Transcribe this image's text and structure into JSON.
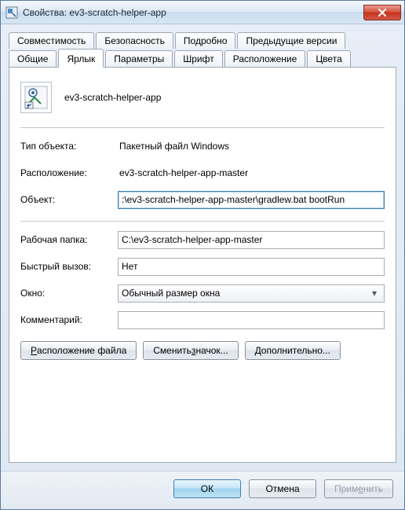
{
  "title": "Свойства: ev3-scratch-helper-app",
  "tabs_row1": [
    {
      "label": "Совместимость"
    },
    {
      "label": "Безопасность"
    },
    {
      "label": "Подробно"
    },
    {
      "label": "Предыдущие версии"
    }
  ],
  "tabs_row2": [
    {
      "label": "Общие"
    },
    {
      "label": "Ярлык"
    },
    {
      "label": "Параметры"
    },
    {
      "label": "Шрифт"
    },
    {
      "label": "Расположение"
    },
    {
      "label": "Цвета"
    }
  ],
  "active_tab": "Ярлык",
  "app_name": "ev3-scratch-helper-app",
  "fields": {
    "type_label": "Тип объекта:",
    "type_value": "Пакетный файл Windows",
    "location_label": "Расположение:",
    "location_value": "ev3-scratch-helper-app-master",
    "target_label": "Объект:",
    "target_value": ":\\ev3-scratch-helper-app-master\\gradlew.bat bootRun",
    "workdir_label": "Рабочая папка:",
    "workdir_value": "C:\\ev3-scratch-helper-app-master",
    "hotkey_label": "Быстрый вызов:",
    "hotkey_value": "Нет",
    "window_label": "Окно:",
    "window_value": "Обычный размер окна",
    "comment_label": "Комментарий:",
    "comment_value": ""
  },
  "buttons": {
    "file_location": "Расположение файла",
    "change_icon": "Сменить значок...",
    "advanced": "Дополнительно..."
  },
  "footer": {
    "ok": "ОК",
    "cancel": "Отмена",
    "apply": "Применить"
  }
}
